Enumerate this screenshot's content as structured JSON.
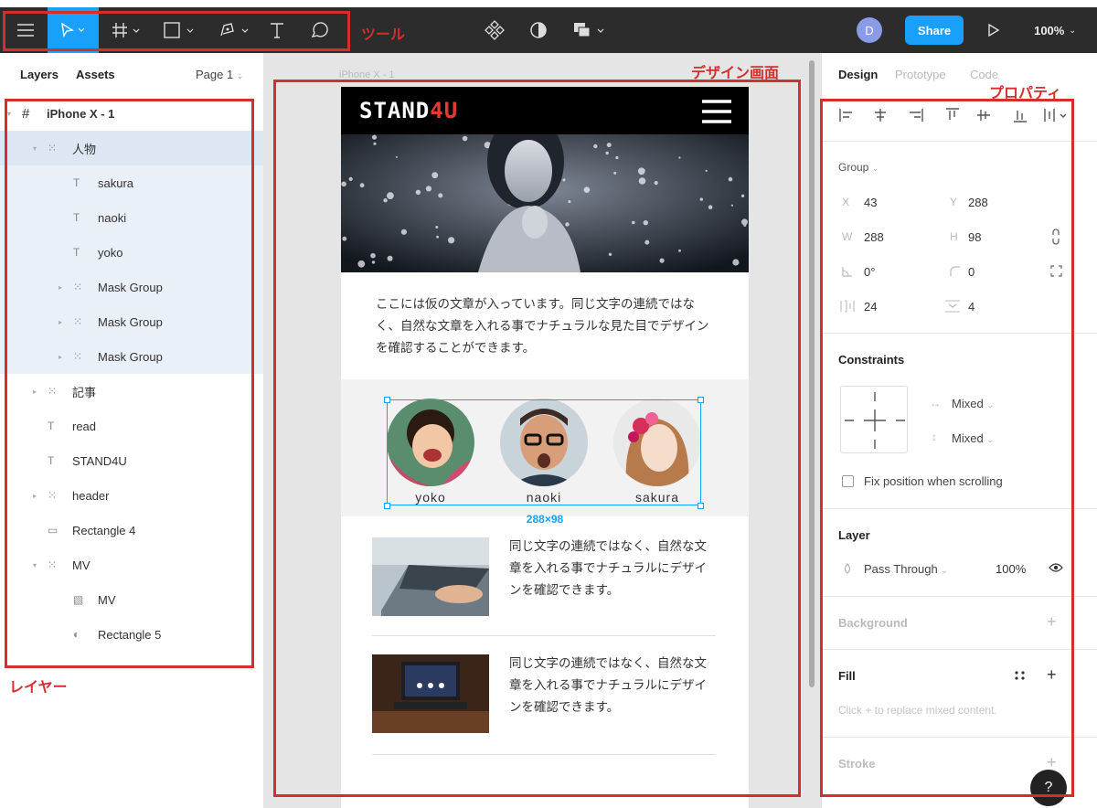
{
  "toolbar": {
    "zoom": "100%",
    "share_label": "Share",
    "avatar_initial": "D",
    "annotation": "ツール"
  },
  "left_panel": {
    "tabs": [
      "Layers",
      "Assets"
    ],
    "page": "Page 1",
    "annotation": "レイヤー",
    "layers": [
      {
        "name": "iPhone X - 1",
        "icon": "frame-icon"
      },
      {
        "name": "人物",
        "icon": "group-icon"
      },
      {
        "name": "sakura",
        "icon": "text-icon"
      },
      {
        "name": "naoki",
        "icon": "text-icon"
      },
      {
        "name": "yoko",
        "icon": "text-icon"
      },
      {
        "name": "Mask Group",
        "icon": "group-icon"
      },
      {
        "name": "Mask Group",
        "icon": "group-icon"
      },
      {
        "name": "Mask Group",
        "icon": "group-icon"
      },
      {
        "name": "記事",
        "icon": "group-icon"
      },
      {
        "name": "read",
        "icon": "text-icon"
      },
      {
        "name": "STAND4U",
        "icon": "text-icon"
      },
      {
        "name": "header",
        "icon": "group-icon"
      },
      {
        "name": "Rectangle 4",
        "icon": "rectangle-icon"
      },
      {
        "name": "MV",
        "icon": "group-icon"
      },
      {
        "name": "MV",
        "icon": "image-icon"
      },
      {
        "name": "Rectangle 5",
        "icon": "ellipse-icon"
      }
    ]
  },
  "canvas": {
    "frame_label": "iPhone X - 1",
    "annotation": "デザイン画面",
    "logo_main": "STAND",
    "logo_accent": "4U",
    "intro_text": "ここには仮の文章が入っています。同じ文字の連続ではなく、自然な文章を入れる事でナチュラルな見た目でデザインを確認することができます。",
    "people": [
      "yoko",
      "naoki",
      "sakura"
    ],
    "selection_size": "288×98",
    "articles": [
      {
        "text": "同じ文字の連続ではなく、自然な文章を入れる事でナチュラルにデザインを確認できます。"
      },
      {
        "text": "同じ文字の連続ではなく、自然な文章を入れる事でナチュラルにデザインを確認できます。"
      }
    ]
  },
  "right_panel": {
    "tabs": [
      "Design",
      "Prototype",
      "Code"
    ],
    "annotation": "プロパティ",
    "group_label": "Group",
    "x_label": "X",
    "x": "43",
    "y_label": "Y",
    "y": "288",
    "w_label": "W",
    "w": "288",
    "h_label": "H",
    "h": "98",
    "rotation": "0°",
    "radius": "0",
    "spacing": "24",
    "padding": "4",
    "constraints_title": "Constraints",
    "constraint_h": "Mixed",
    "constraint_v": "Mixed",
    "fix_position_label": "Fix position when scrolling",
    "layer_title": "Layer",
    "blend_mode": "Pass Through",
    "opacity": "100%",
    "background_title": "Background",
    "fill_title": "Fill",
    "fill_hint": "Click + to replace mixed content.",
    "stroke_title": "Stroke",
    "help": "?"
  },
  "colors": {
    "toolbar_bg": "#2c2c2c",
    "accent_blue": "#18a0fb",
    "annotation_red": "#d32f2f",
    "logo_accent": "#e53935"
  }
}
